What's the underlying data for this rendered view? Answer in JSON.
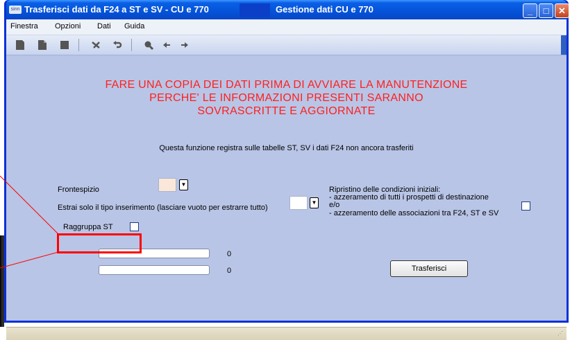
{
  "window": {
    "title": "Trasferisci dati da F24 a ST e SV - CU e 770",
    "title_secondary": "Gestione dati CU e 770",
    "icon_text": "sinn",
    "min_glyph": "_",
    "max_glyph": "□",
    "close_glyph": "✕"
  },
  "menu": {
    "items": [
      "Finestra",
      "Opzioni",
      "Dati",
      "Guida"
    ]
  },
  "toolbar": {
    "icons": [
      "new-doc-icon",
      "copy-doc-icon",
      "save-icon",
      "delete-icon",
      "undo-icon",
      "search-icon",
      "back-icon",
      "forward-icon"
    ]
  },
  "main": {
    "warning_lines": [
      "FARE UNA COPIA DEI DATI PRIMA DI AVVIARE LA MANUTENZIONE",
      "PERCHE' LE INFORMAZIONI PRESENTI SARANNO",
      "SOVRASCRITTE E AGGIORNATE"
    ],
    "info": "Questa funzione registra sulle tabelle ST, SV i dati F24 non ancora trasferiti",
    "frontespizio_label": "Frontespizio",
    "estrai_label": "Estrai solo il tipo inserimento (lasciare vuoto per estrarre tutto)",
    "raggruppa_label": "Raggruppa ST",
    "ripristino_title": "Ripristino delle condizioni iniziali:",
    "ripristino_line1": "- azzeramento di tutti i prospetti di destinazione",
    "ripristino_line1b": "e/o",
    "ripristino_line2": "- azzeramento delle associazioni tra F24, ST e SV",
    "progress1_count": "0",
    "progress2_count": "0",
    "transfer_button": "Trasferisci"
  },
  "colors": {
    "warning": "#ff2020",
    "highlight": "#ff0000",
    "client_bg": "#b8c5e6"
  }
}
